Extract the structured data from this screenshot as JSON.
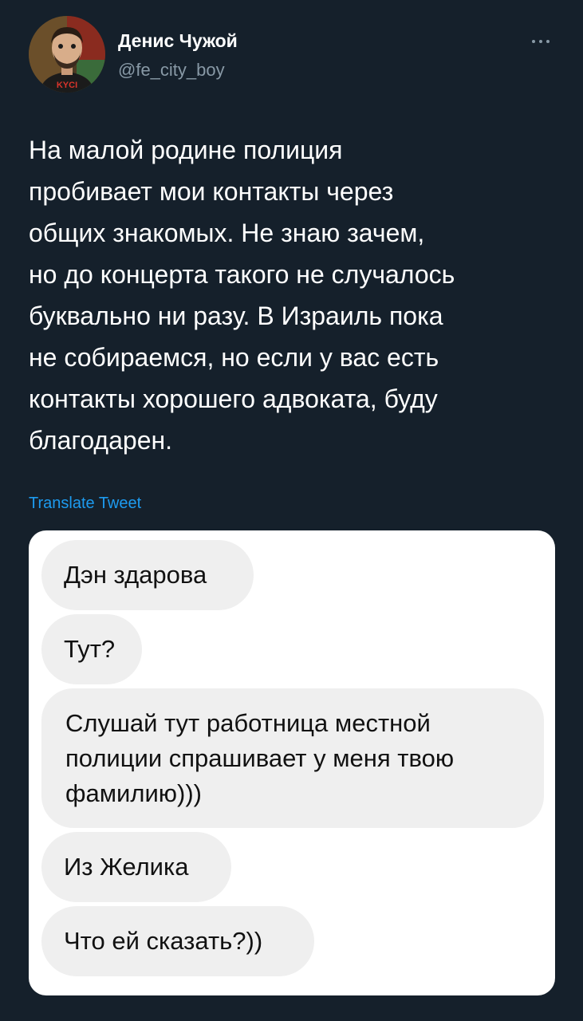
{
  "author": {
    "name": "Денис Чужой",
    "handle": "@fe_city_boy",
    "avatar": {
      "icon": "avatar-illustration",
      "shirt_text": "KYCI"
    }
  },
  "tweet": {
    "text": "На малой родине полиция\nпробивает мои контакты через\nобщих знакомых. Не знаю зачем,\nно до концерта такого не случалось\nбуквально ни разу. В Израиль пока\nне собираемся, но если у вас есть\nконтакты хорошего адвоката, буду\nблагодарен.",
    "translate_label": "Translate Tweet"
  },
  "media": {
    "messages": [
      {
        "text": "Дэн здарова"
      },
      {
        "text": "Тут?"
      },
      {
        "text": "Слушай тут работница местной\nполиции спрашивает у меня твою\nфамилию)))"
      },
      {
        "text": "Из Желика"
      },
      {
        "text": "Что ей сказать?))"
      }
    ]
  },
  "colors": {
    "background": "#15202b",
    "text": "#ffffff",
    "secondary_text": "#8899a6",
    "link": "#1d9bf0",
    "bubble": "#efefef"
  }
}
